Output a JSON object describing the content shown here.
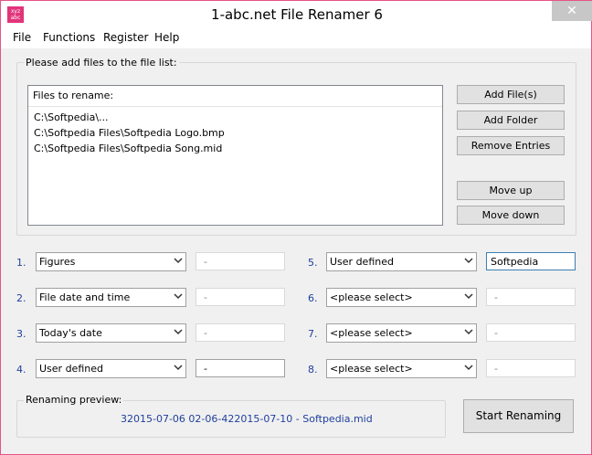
{
  "window": {
    "title": "1-abc.net File Renamer 6",
    "icon_text": "xyz abc",
    "close_glyph": "✕"
  },
  "menu": [
    "File",
    "Functions",
    "Register",
    "Help"
  ],
  "files_group": {
    "label": "Please add files to the file list:",
    "list_header": "Files to rename:",
    "files": [
      "C:\\Softpedia\\...",
      "C:\\Softpedia Files\\Softpedia Logo.bmp",
      "C:\\Softpedia Files\\Softpedia Song.mid"
    ]
  },
  "buttons": {
    "add_files": "Add File(s)",
    "add_folder": "Add Folder",
    "remove_entries": "Remove Entries",
    "move_up": "Move up",
    "move_down": "Move down",
    "start_renaming": "Start Renaming"
  },
  "rules": [
    {
      "num": "1.",
      "select": "Figures",
      "value": "-"
    },
    {
      "num": "2.",
      "select": "File date and time",
      "value": "-"
    },
    {
      "num": "3.",
      "select": "Today's date",
      "value": "-"
    },
    {
      "num": "4.",
      "select": "User defined",
      "value": "-"
    },
    {
      "num": "5.",
      "select": "User defined",
      "value": "Softpedia"
    },
    {
      "num": "6.",
      "select": "<please select>",
      "value": "-"
    },
    {
      "num": "7.",
      "select": "<please select>",
      "value": "-"
    },
    {
      "num": "8.",
      "select": "<please select>",
      "value": "-"
    }
  ],
  "preview": {
    "label": "Renaming preview:",
    "text": "32015-07-06 02-06-422015-07-10 - Softpedia.mid"
  },
  "colors": {
    "frame": "#e6538a",
    "accent_blue": "#1f3f9d",
    "icon_bg": "#e2347a"
  }
}
